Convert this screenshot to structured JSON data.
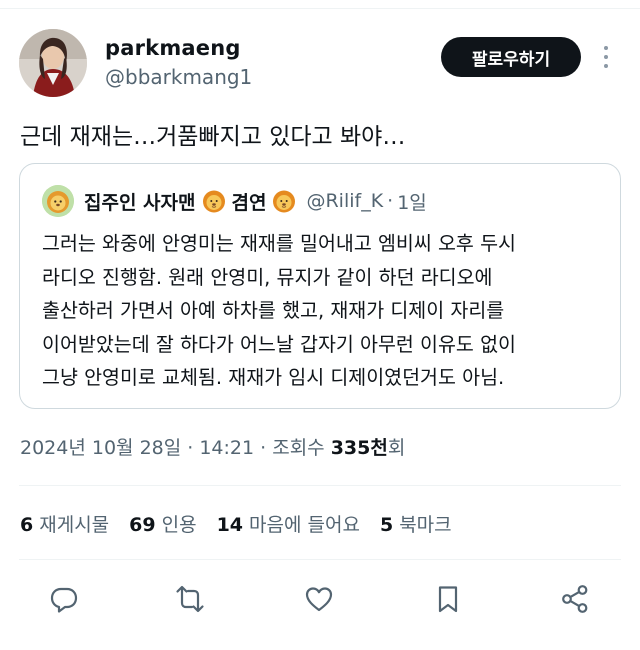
{
  "author": {
    "name": "parkmaeng",
    "handle": "@bbarkmang1",
    "avatar_icon": "profile-photo"
  },
  "follow_button_label": "팔로우하기",
  "more_icon": "more-vertical-icon",
  "tweet_text": "근데 재재는…거품빠지고 있다고 봐야…",
  "quote": {
    "name_part1": "집주인 사자맨",
    "name_part2": "겸연",
    "emoji": "lion-face-emoji",
    "handle": "@Rilif_K",
    "separator": "·",
    "time": "1일",
    "body_lines": [
      "그러는 와중에 안영미는 재재를 밀어내고 엠비씨 오후 두시",
      "라디오 진행함. 원래 안영미, 뮤지가 같이 하던 라디오에",
      "출산하러 가면서 아예 하차를 했고, 재재가 디제이 자리를",
      "이어받았는데 잘 하다가 어느날 갑자기 아무런 이유도 없이",
      "그냥 안영미로 교체됨. 재재가 임시 디제이였던거도 아님."
    ]
  },
  "meta": {
    "timestamp": "2024년 10월 28일 · 14:21 · 조회수 ",
    "views_count": "335천",
    "views_suffix": "회"
  },
  "stats": [
    {
      "count": "6",
      "label": "재게시물"
    },
    {
      "count": "69",
      "label": "인용"
    },
    {
      "count": "14",
      "label": "마음에 들어요"
    },
    {
      "count": "5",
      "label": "북마크"
    }
  ],
  "actions": [
    "reply-icon",
    "repost-icon",
    "like-icon",
    "bookmark-icon",
    "share-icon"
  ],
  "colors": {
    "text_primary": "#0f1419",
    "text_secondary": "#536471",
    "border": "#cfd9de",
    "button_bg": "#0f1419"
  }
}
